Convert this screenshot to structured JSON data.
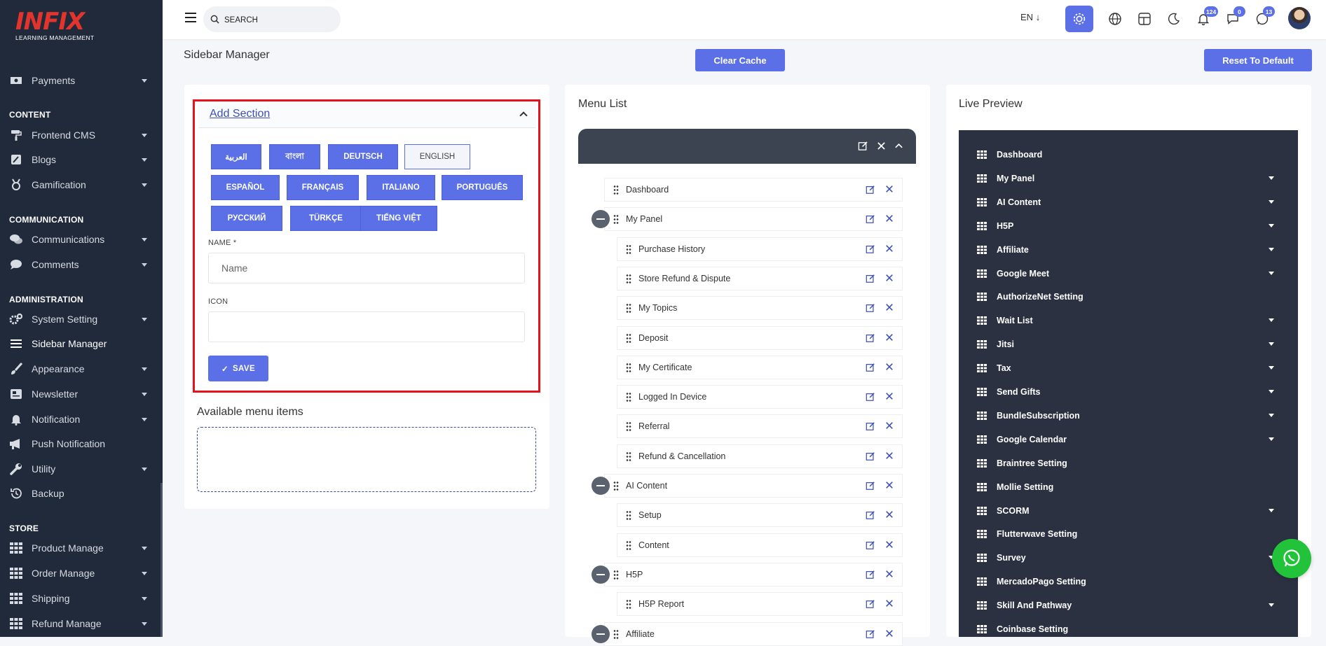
{
  "logo": {
    "mark": "INFIX",
    "sub": "LEARNING MANAGEMENT"
  },
  "sidebar": {
    "cut_label": "Payments",
    "sections": [
      {
        "heading": "CONTENT"
      },
      {
        "heading": "COMMUNICATION"
      },
      {
        "heading": "ADMINISTRATION"
      },
      {
        "heading": "STORE"
      }
    ],
    "items": [
      {
        "label": "Payments",
        "icon": "money-icon",
        "arrow": true
      },
      {
        "label": "Frontend CMS",
        "icon": "paint-roller-icon",
        "arrow": true
      },
      {
        "label": "Blogs",
        "icon": "edit-box-icon",
        "arrow": true
      },
      {
        "label": "Gamification",
        "icon": "award-icon",
        "arrow": true
      },
      {
        "label": "Communications",
        "icon": "chat-bubbles-icon",
        "arrow": true
      },
      {
        "label": "Comments",
        "icon": "comment-icon",
        "arrow": true
      },
      {
        "label": "System Setting",
        "icon": "gears-icon",
        "arrow": true
      },
      {
        "label": "Sidebar Manager",
        "icon": "bars-icon",
        "arrow": false
      },
      {
        "label": "Appearance",
        "icon": "brush-icon",
        "arrow": true
      },
      {
        "label": "Newsletter",
        "icon": "newsletter-icon",
        "arrow": true
      },
      {
        "label": "Notification",
        "icon": "bell-icon",
        "arrow": true
      },
      {
        "label": "Push Notification",
        "icon": "megaphone-icon",
        "arrow": false
      },
      {
        "label": "Utility",
        "icon": "wrench-icon",
        "arrow": true
      },
      {
        "label": "Backup",
        "icon": "history-icon",
        "arrow": false
      },
      {
        "label": "Product Manage",
        "icon": "grid-icon",
        "arrow": true
      },
      {
        "label": "Order Manage",
        "icon": "grid-icon",
        "arrow": true
      },
      {
        "label": "Shipping",
        "icon": "grid-icon",
        "arrow": true
      },
      {
        "label": "Refund Manage",
        "icon": "grid-icon",
        "arrow": true
      }
    ]
  },
  "topbar": {
    "search_placeholder": "SEARCH",
    "language": "EN",
    "badges": {
      "notifications": "124",
      "messages": "0",
      "chat": "13"
    }
  },
  "page": {
    "title": "Sidebar Manager",
    "clear_cache": "Clear Cache",
    "reset_default": "Reset To Default"
  },
  "add_section": {
    "title": "Add Section",
    "languages": [
      "العربية",
      "বাংলা",
      "DEUTSCH",
      "ENGLISH",
      "ESPAÑOL",
      "FRANÇAIS",
      "ITALIANO",
      "PORTUGUÊS",
      "РУССКИЙ",
      "TÜRKÇE",
      "TIẾNG VIỆT"
    ],
    "selected_language": "ENGLISH",
    "name_label": "NAME *",
    "name_placeholder": "Name",
    "icon_label": "ICON",
    "icon_value": "",
    "save": "SAVE"
  },
  "available": {
    "title": "Available menu items"
  },
  "menu_list": {
    "title": "Menu List",
    "rows": [
      {
        "label": "Dashboard",
        "level": 0,
        "collapse": false
      },
      {
        "label": "My Panel",
        "level": 0,
        "collapse": true
      },
      {
        "label": "Purchase History",
        "level": 1
      },
      {
        "label": "Store Refund & Dispute",
        "level": 1
      },
      {
        "label": "My Topics",
        "level": 1
      },
      {
        "label": "Deposit",
        "level": 1
      },
      {
        "label": "My Certificate",
        "level": 1
      },
      {
        "label": "Logged In Device",
        "level": 1
      },
      {
        "label": "Referral",
        "level": 1
      },
      {
        "label": "Refund & Cancellation",
        "level": 1
      },
      {
        "label": "AI Content",
        "level": 0,
        "collapse": true
      },
      {
        "label": "Setup",
        "level": 1
      },
      {
        "label": "Content",
        "level": 1
      },
      {
        "label": "H5P",
        "level": 0,
        "collapse": true
      },
      {
        "label": "H5P Report",
        "level": 1
      },
      {
        "label": "Affiliate",
        "level": 0,
        "collapse": true
      }
    ]
  },
  "live_preview": {
    "title": "Live Preview",
    "items": [
      {
        "label": "Dashboard",
        "arrow": false
      },
      {
        "label": "My Panel",
        "arrow": true
      },
      {
        "label": "AI Content",
        "arrow": true
      },
      {
        "label": "H5P",
        "arrow": true
      },
      {
        "label": "Affiliate",
        "arrow": true
      },
      {
        "label": "Google Meet",
        "arrow": true
      },
      {
        "label": "AuthorizeNet Setting",
        "arrow": false
      },
      {
        "label": "Wait List",
        "arrow": true
      },
      {
        "label": "Jitsi",
        "arrow": true
      },
      {
        "label": "Tax",
        "arrow": true
      },
      {
        "label": "Send Gifts",
        "arrow": true
      },
      {
        "label": "BundleSubscription",
        "arrow": true
      },
      {
        "label": "Google Calendar",
        "arrow": true
      },
      {
        "label": "Braintree Setting",
        "arrow": false
      },
      {
        "label": "Mollie Setting",
        "arrow": false
      },
      {
        "label": "SCORM",
        "arrow": true
      },
      {
        "label": "Flutterwave Setting",
        "arrow": false
      },
      {
        "label": "Survey",
        "arrow": true
      },
      {
        "label": "MercadoPago Setting",
        "arrow": false
      },
      {
        "label": "Skill And Pathway",
        "arrow": true
      },
      {
        "label": "Coinbase Setting",
        "arrow": false
      }
    ]
  },
  "colors": {
    "accent": "#5b6fe6",
    "sidebar": "#202a3b",
    "highlight": "#e6131a",
    "whatsapp": "#22c33a"
  }
}
